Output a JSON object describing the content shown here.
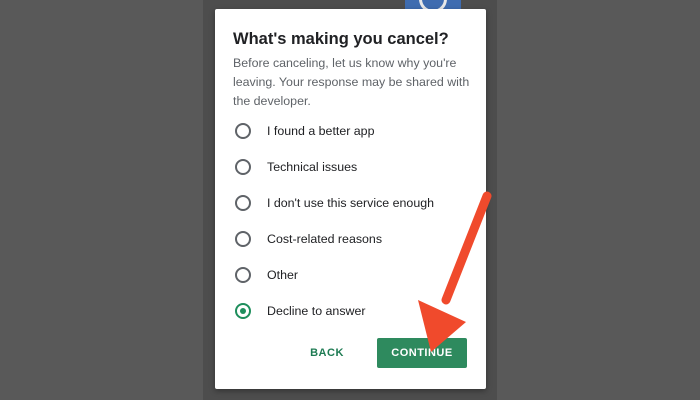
{
  "dialog": {
    "title": "What's making you cancel?",
    "description": "Before canceling, let us know why you're leaving. Your response may be shared with the developer.",
    "options": [
      {
        "label": "I found a better app",
        "checked": false
      },
      {
        "label": "Technical issues",
        "checked": false
      },
      {
        "label": "I don't use this service enough",
        "checked": false
      },
      {
        "label": "Cost-related reasons",
        "checked": false
      },
      {
        "label": "Other",
        "checked": false
      },
      {
        "label": "Decline to answer",
        "checked": true
      }
    ],
    "back_label": "BACK",
    "continue_label": "CONTINUE"
  },
  "colors": {
    "background": "#595959",
    "accent": "#2e8a5e",
    "arrow": "#f04a2c"
  }
}
